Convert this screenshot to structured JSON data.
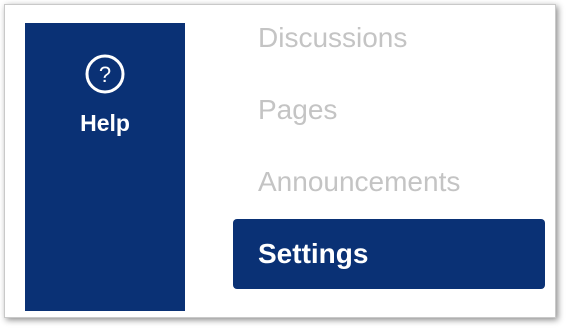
{
  "global_nav": {
    "help": {
      "icon": "help-circle-icon",
      "label": "Help"
    },
    "background_color": "#0a3175"
  },
  "course_nav": {
    "items": [
      {
        "label": "Discussions",
        "active": false
      },
      {
        "label": "Pages",
        "active": false
      },
      {
        "label": "Announcements",
        "active": false
      },
      {
        "label": "Settings",
        "active": true
      }
    ],
    "inactive_text_color": "#c4c4c4",
    "active_background_color": "#0a3175",
    "active_text_color": "#ffffff"
  }
}
